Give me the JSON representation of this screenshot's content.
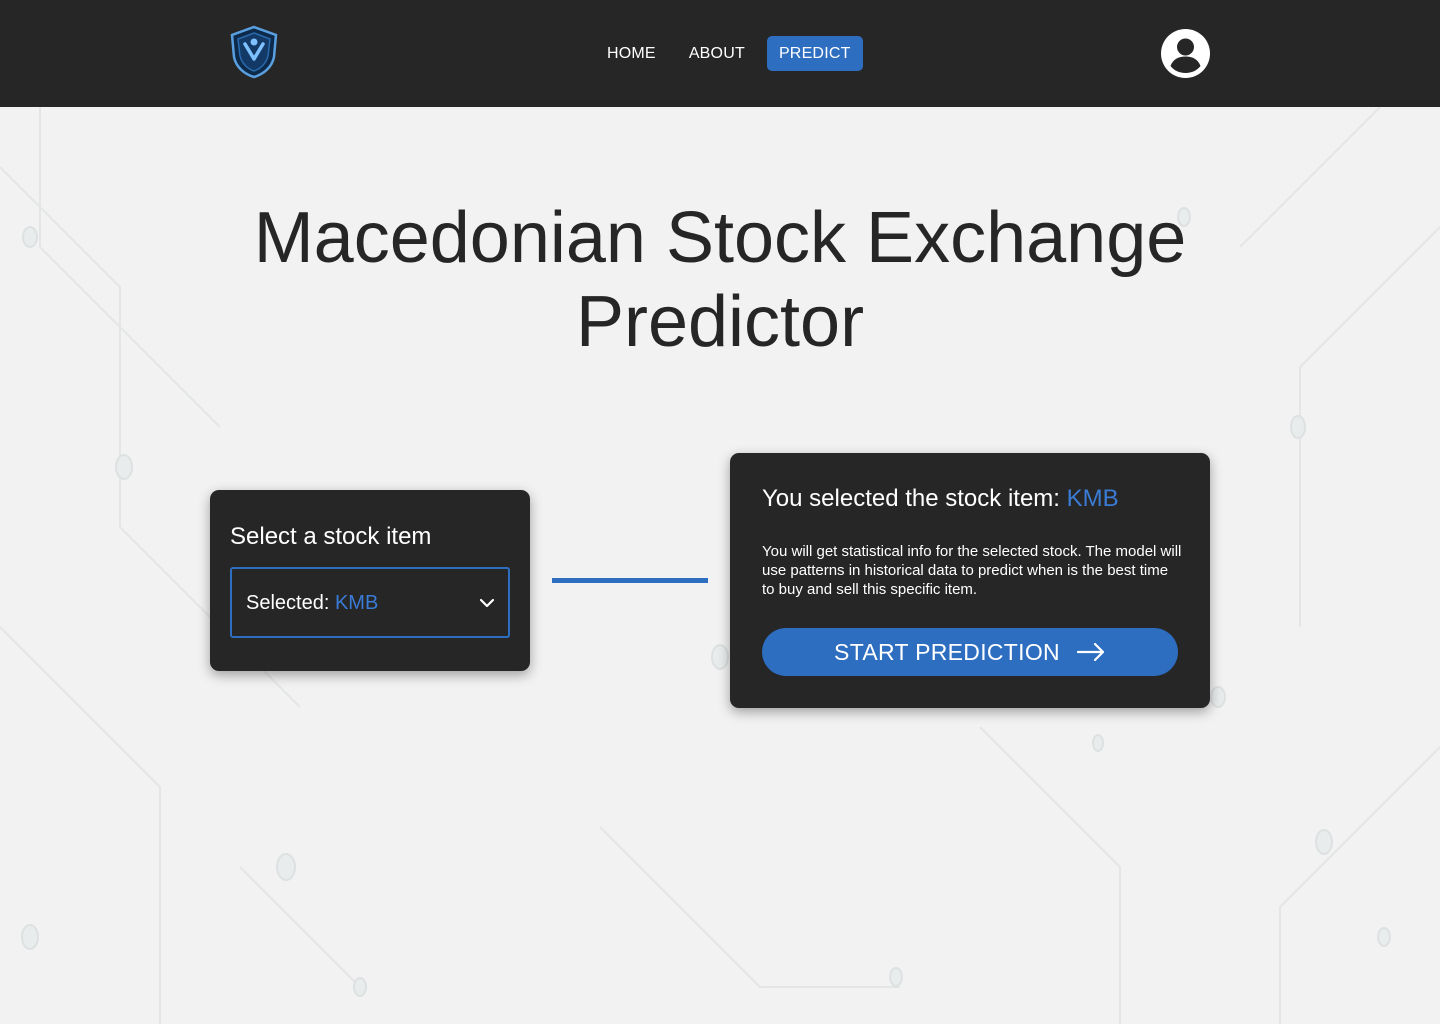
{
  "nav": {
    "logo": "shield-logo",
    "links": [
      {
        "label": "HOME",
        "active": false
      },
      {
        "label": "ABOUT",
        "active": false
      },
      {
        "label": "PREDICT",
        "active": true
      }
    ],
    "avatar_icon": "user-circle-icon"
  },
  "page": {
    "title_line1": "Macedonian Stock Exchange",
    "title_line2": "Predictor"
  },
  "select_card": {
    "title": "Select a stock item",
    "selected_prefix": "Selected: ",
    "selected_value": "KMB",
    "dropdown_icon": "chevron-down-icon"
  },
  "info_card": {
    "title_prefix": "You selected the stock item: ",
    "title_value": "KMB",
    "description": "You will get statistical info for the selected stock. The model will use patterns in historical data to predict when is the best time to buy and sell this specific item.",
    "button_label": "START PREDICTION",
    "button_icon": "arrow-right-icon"
  },
  "colors": {
    "accent": "#2e6ec0",
    "accent_text": "#3a7bd5",
    "dark": "#262626",
    "background": "#f2f2f2"
  }
}
